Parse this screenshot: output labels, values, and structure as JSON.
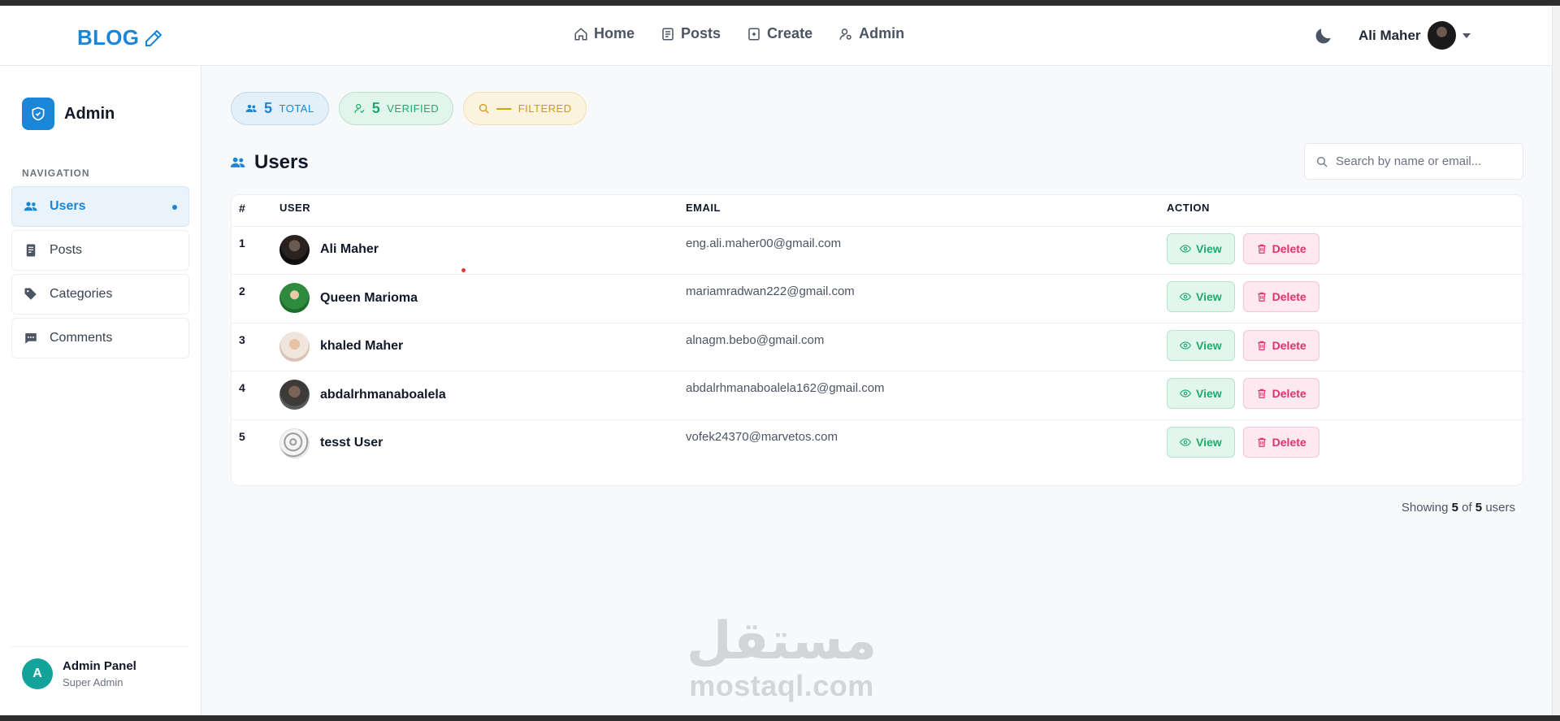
{
  "navbar": {
    "brand": "BLOG",
    "links": [
      {
        "label": "Home",
        "icon": "home-icon"
      },
      {
        "label": "Posts",
        "icon": "posts-icon"
      },
      {
        "label": "Create",
        "icon": "create-icon"
      },
      {
        "label": "Admin",
        "icon": "admin-icon"
      }
    ],
    "user_name": "Ali Maher"
  },
  "sidebar": {
    "title": "Admin",
    "section_label": "NAVIGATION",
    "items": [
      {
        "label": "Users",
        "icon": "users-icon",
        "active": true
      },
      {
        "label": "Posts",
        "icon": "posts-icon",
        "active": false
      },
      {
        "label": "Categories",
        "icon": "tag-icon",
        "active": false
      },
      {
        "label": "Comments",
        "icon": "comment-icon",
        "active": false
      }
    ],
    "footer": {
      "initial": "A",
      "name": "Admin Panel",
      "role": "Super Admin"
    }
  },
  "stats": {
    "total": {
      "value": "5",
      "label": "TOTAL"
    },
    "verified": {
      "value": "5",
      "label": "VERIFIED"
    },
    "filtered": {
      "value": "—",
      "label": "FILTERED"
    }
  },
  "main": {
    "title": "Users",
    "search_placeholder": "Search by name or email...",
    "columns": [
      "#",
      "USER",
      "EMAIL",
      "ACTION"
    ],
    "rows": [
      {
        "num": "1",
        "name": "Ali Maher",
        "email": "eng.ali.maher00@gmail.com"
      },
      {
        "num": "2",
        "name": "Queen Marioma",
        "email": "mariamradwan222@gmail.com"
      },
      {
        "num": "3",
        "name": "khaled Maher",
        "email": "alnagm.bebo@gmail.com"
      },
      {
        "num": "4",
        "name": "abdalrhmanaboalela",
        "email": "abdalrhmanaboalela162@gmail.com"
      },
      {
        "num": "5",
        "name": "tesst User",
        "email": "vofek24370@marvetos.com"
      }
    ],
    "view_label": "View",
    "delete_label": "Delete",
    "showing": {
      "prefix": "Showing",
      "shown": "5",
      "of": "of",
      "total": "5",
      "suffix": "users"
    }
  },
  "watermark": {
    "arabic": "مستقل",
    "latin": "mostaql.com"
  },
  "colors": {
    "accent": "#1a86d8",
    "success": "#1faa6b",
    "danger": "#e0316b",
    "warning": "#cf9b14"
  }
}
